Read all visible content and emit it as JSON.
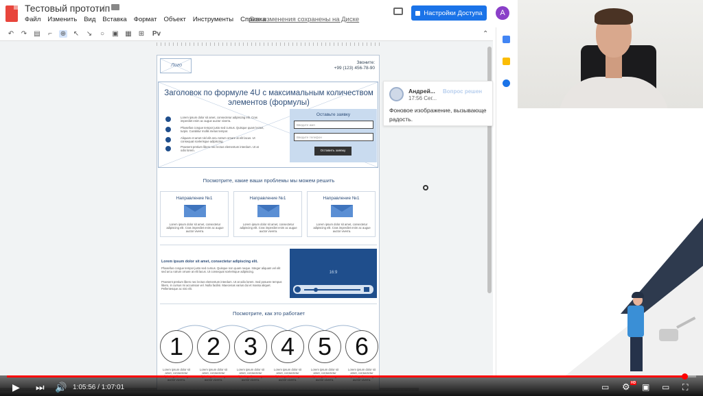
{
  "app": {
    "doc_title": "Тестовый прототип",
    "menu": [
      "Файл",
      "Изменить",
      "Вид",
      "Вставка",
      "Формат",
      "Объект",
      "Инструменты",
      "Справка"
    ],
    "save_status": "Все изменения сохранены на Диске",
    "share_label": "Настройки Доступа",
    "avatar_letter": "A",
    "accent": "#1a73e8"
  },
  "toolbar": {
    "tools": [
      "undo-icon",
      "redo-icon",
      "print-icon",
      "paint-format-icon",
      "zoom-icon",
      "cursor-icon",
      "line-icon",
      "shape-icon",
      "textbox-icon",
      "image-icon",
      "comment-add-icon",
      "text-style-icon"
    ],
    "text_tool_label": "Pv"
  },
  "wireframe": {
    "logo_label": "Лого",
    "phone_label": "Звоните:",
    "phone_number": "+99 (123) 456-78-90",
    "hero_title": "Заголовок по формуле 4U с максимальным количеством элементов (формулы)",
    "bullets": [
      "Lorem ipsum dolor sit amet, consectetur adipiscing elit. Cras imperdiet enim ac augue auctor viverra.",
      "Phasellus congue tempor justo sed cursus. Quisque quam lectus, turpis. Curabitur mollis metus tempor.",
      "Aliquam et amet nisl elit arcu rutrum ornare at elit lacus. Ut consequat scelerisque adipiscing.",
      "Praesent pretium libero nec lectus elementum interdum. Ut at odio lorem."
    ],
    "form": {
      "title": "Оставьте заявку",
      "name_placeholder": "Введите имя",
      "phone_placeholder": "Введите телефон",
      "submit_label": "Оставить заявку"
    },
    "problems_title": "Посмотрите, какие ваши проблемы мы можем решить",
    "cards": [
      {
        "title": "Направление №1",
        "text": "Lorem ipsum dolor sit amet, consectetur adipiscing elit. Cras imperdiet enim ac augue auctor viverra."
      },
      {
        "title": "Направление №1",
        "text": "Lorem ipsum dolor sit amet, consectetur adipiscing elit. Cras imperdiet enim ac augue auctor viverra."
      },
      {
        "title": "Направление №1",
        "text": "Lorem ipsum dolor sit amet, consectetur adipiscing elit. Cras imperdiet enim ac augue auctor viverra."
      }
    ],
    "lorem_heading": "Lorem ipsum dolor sit amet, consectetur adipiscing elit.",
    "lorem_p1": "Phasellus congue tempor justo sed cursus. Quisque non quam neque. Integer aliquam vel elit sed arcu rutrum ornare at elit lacus. Ut consequat scelerisque adipiscing.",
    "lorem_p2": "Praesent pretium libero nec lectus elementum interdum. Ut at odio lorem. Sed posuere tempus libero, in cursus mi accumsan vel. Nulla facilisi. Maecenas varius dui et massa aliquet. Pellentesque ac nisi elit.",
    "video_ratio": "16:9",
    "how_title": "Посмотрите, как это работает",
    "steps": [
      "1",
      "2",
      "3",
      "4",
      "5",
      "6"
    ],
    "step_text": "Lorem ipsum dolor sit amet, consectetur adipiscing elit ac augue auctor viverra."
  },
  "comment": {
    "author": "Андрей...",
    "time": "17:56 Сег...",
    "resolve_label": "Вопрос решен",
    "text": "Фоновое изображение, вызывающе радость."
  },
  "player": {
    "time": "1:05:56 / 1:07:01",
    "progress": 0.983,
    "hd_label": "HD"
  }
}
